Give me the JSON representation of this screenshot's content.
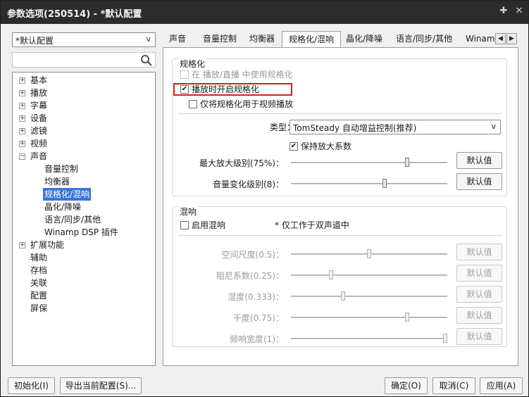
{
  "window": {
    "title": "参数选项(250514) - *默认配置",
    "pin_icon": "pin-icon",
    "close_icon": "close-icon"
  },
  "profile": {
    "selected": "*默认配置",
    "arrow": "v"
  },
  "search": {
    "value": "",
    "icon": "search-icon"
  },
  "tree": {
    "items": [
      {
        "label": "基本",
        "expander": "+"
      },
      {
        "label": "播放",
        "expander": "+"
      },
      {
        "label": "字幕",
        "expander": "+"
      },
      {
        "label": "设备",
        "expander": "+"
      },
      {
        "label": "滤镜",
        "expander": "+"
      },
      {
        "label": "视频",
        "expander": "+"
      },
      {
        "label": "声音",
        "expander": "−"
      },
      {
        "label": "音量控制"
      },
      {
        "label": "均衡器"
      },
      {
        "label": "规格化/混响",
        "selected": true
      },
      {
        "label": "晶化/降噪"
      },
      {
        "label": "语言/同步/其他"
      },
      {
        "label": "Winamp DSP 插件"
      },
      {
        "label": "扩展功能",
        "expander": "+"
      },
      {
        "label": "辅助"
      },
      {
        "label": "存档"
      },
      {
        "label": "关联"
      },
      {
        "label": "配置"
      },
      {
        "label": "屏保"
      }
    ]
  },
  "tabs": [
    {
      "label": "声音"
    },
    {
      "label": "音量控制"
    },
    {
      "label": "均衡器"
    },
    {
      "label": "规格化/混响",
      "active": true
    },
    {
      "label": "晶化/降噪"
    },
    {
      "label": "语言/同步/其他"
    },
    {
      "label": "Winamp"
    }
  ],
  "tab_scroll": {
    "left": "◀",
    "right": "▶"
  },
  "normalize": {
    "title": "规格化",
    "opt_live": {
      "label": "在 播放/直播 中使用规格化",
      "checked": false,
      "enabled": false
    },
    "opt_enable": {
      "label": "播放时开启规格化",
      "checked": true
    },
    "opt_video_only": {
      "label": "仅将规格化用于视频播放",
      "checked": false
    },
    "type_label": "类型：",
    "type_value": "TomSteady 自动增益控制(推荐)",
    "type_arrow": "v",
    "keep_factor": {
      "label": "保持放大系数",
      "checked": true
    },
    "max_level": {
      "label": "最大放大级别(75%)：",
      "value": 0.75,
      "button": "默认值"
    },
    "vol_change": {
      "label": "音量变化级别(8)：",
      "value": 0.6,
      "button": "默认值"
    }
  },
  "reverb": {
    "title": "混响",
    "enable": {
      "label": "启用混响",
      "checked": false
    },
    "note": "* 仅工作于双声道中",
    "rows": [
      {
        "label": "空间尺度(0.5)：",
        "value": 0.5,
        "button": "默认值"
      },
      {
        "label": "阻尼系数(0.25)：",
        "value": 0.25,
        "button": "默认值"
      },
      {
        "label": "湿度(0.333)：",
        "value": 0.33,
        "button": "默认值"
      },
      {
        "label": "干度(0.75)：",
        "value": 0.75,
        "button": "默认值"
      },
      {
        "label": "频响宽度(1)：",
        "value": 1.0,
        "button": "默认值"
      }
    ]
  },
  "footer": {
    "init": "初始化(I)",
    "export": "导出当前配置(S)...",
    "ok": "确定(O)",
    "cancel": "取消(C)",
    "apply": "应用(A)"
  }
}
